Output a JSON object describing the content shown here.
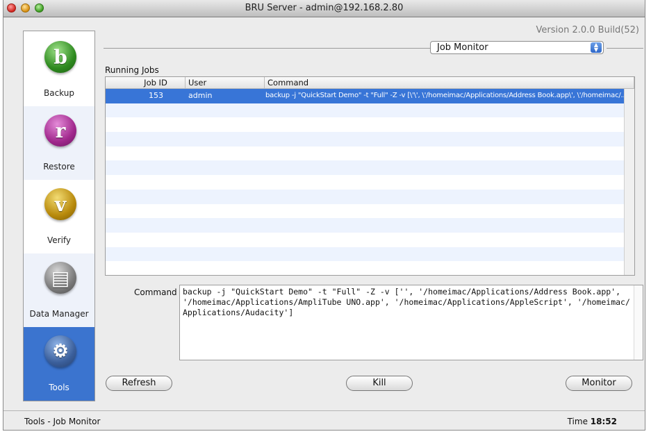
{
  "window": {
    "title": "BRU Server - admin@192.168.2.80",
    "version": "Version 2.0.0 Build(52)"
  },
  "sidebar": {
    "items": [
      {
        "label": "Backup",
        "icon": "backup-icon",
        "glyph": "b"
      },
      {
        "label": "Restore",
        "icon": "restore-icon",
        "glyph": "r"
      },
      {
        "label": "Verify",
        "icon": "verify-icon",
        "glyph": "v"
      },
      {
        "label": "Data Manager",
        "icon": "data-manager-icon",
        "glyph": "▤"
      },
      {
        "label": "Tools",
        "icon": "tools-icon",
        "glyph": "⚙",
        "selected": true
      }
    ]
  },
  "view_selector": {
    "value": "Job Monitor"
  },
  "running_jobs": {
    "label": "Running Jobs",
    "columns": [
      "Job ID",
      "User",
      "Command"
    ],
    "rows": [
      {
        "job_id": "153",
        "user": "admin",
        "command": "backup -j \"QuickStart Demo\" -t \"Full\" -Z -v [\\'\\', \\'/homeimac/Applications/Address Book.app\\', \\'/homeimac/...",
        "selected": true
      }
    ]
  },
  "command_detail": {
    "label": "Command",
    "value": "backup -j \"QuickStart Demo\" -t \"Full\" -Z -v ['', '/homeimac/Applications/Address Book.app', '/homeimac/Applications/AmpliTube UNO.app', '/homeimac/Applications/AppleScript', '/homeimac/Applications/Audacity']"
  },
  "buttons": {
    "refresh": "Refresh",
    "kill": "Kill",
    "monitor": "Monitor"
  },
  "status": {
    "left": "Tools - Job Monitor",
    "time_label": "Time",
    "time_value": "18:52"
  },
  "colors": {
    "selection": "#3875d7",
    "sidebar_selected": "#3b74cf",
    "row_alt": "#edf3fe"
  }
}
